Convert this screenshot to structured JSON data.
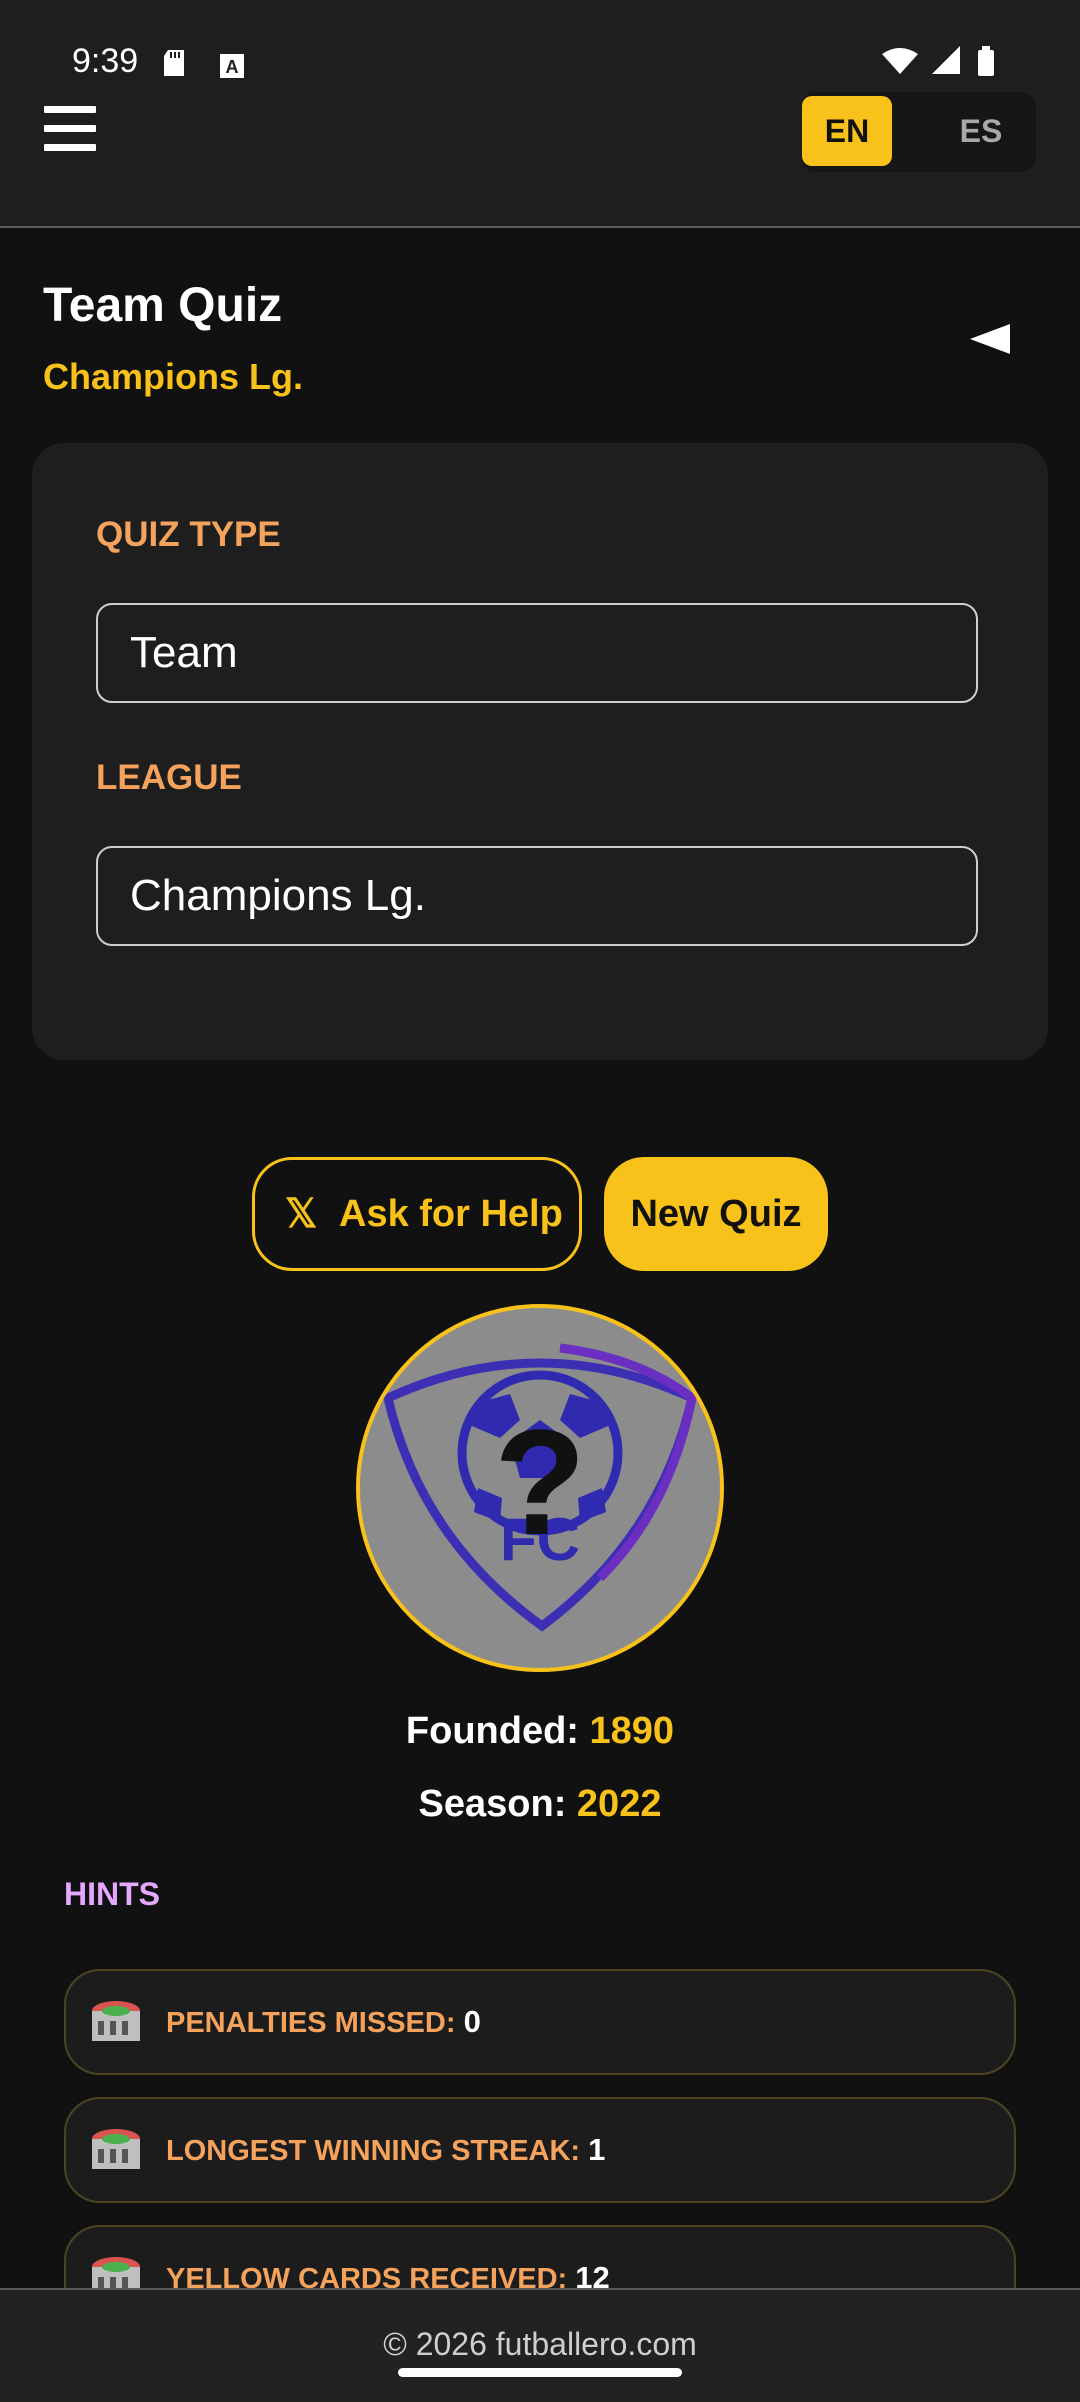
{
  "status_bar": {
    "time": "9:39"
  },
  "header": {
    "lang_en": "EN",
    "lang_es": "ES",
    "active_lang": "EN"
  },
  "page": {
    "title": "Team Quiz",
    "subtitle": "Champions Lg."
  },
  "form": {
    "quiz_type_label": "QUIZ TYPE",
    "quiz_type_value": "Team",
    "league_label": "LEAGUE",
    "league_value": "Champions Lg."
  },
  "actions": {
    "help_icon": "𝕏",
    "help_label": "Ask for Help",
    "new_label": "New Quiz"
  },
  "team": {
    "logo_mark": "?",
    "logo_letters": "FC",
    "founded_label": "Founded: ",
    "founded_value": "1890",
    "season_label": "Season: ",
    "season_value": "2022"
  },
  "hints": {
    "title": "HINTS",
    "items": [
      {
        "label": "PENALTIES MISSED: ",
        "value": "0"
      },
      {
        "label": "LONGEST WINNING STREAK: ",
        "value": "1"
      },
      {
        "label": "YELLOW CARDS RECEIVED: ",
        "value": "12"
      }
    ]
  },
  "footer": {
    "text": "© 2026 futballero.com"
  },
  "colors": {
    "accent": "#f8c21a",
    "label_orange": "#f5a35c",
    "hints_purple": "#e4a8ff",
    "background": "#111111",
    "card": "#1e1e1e"
  }
}
